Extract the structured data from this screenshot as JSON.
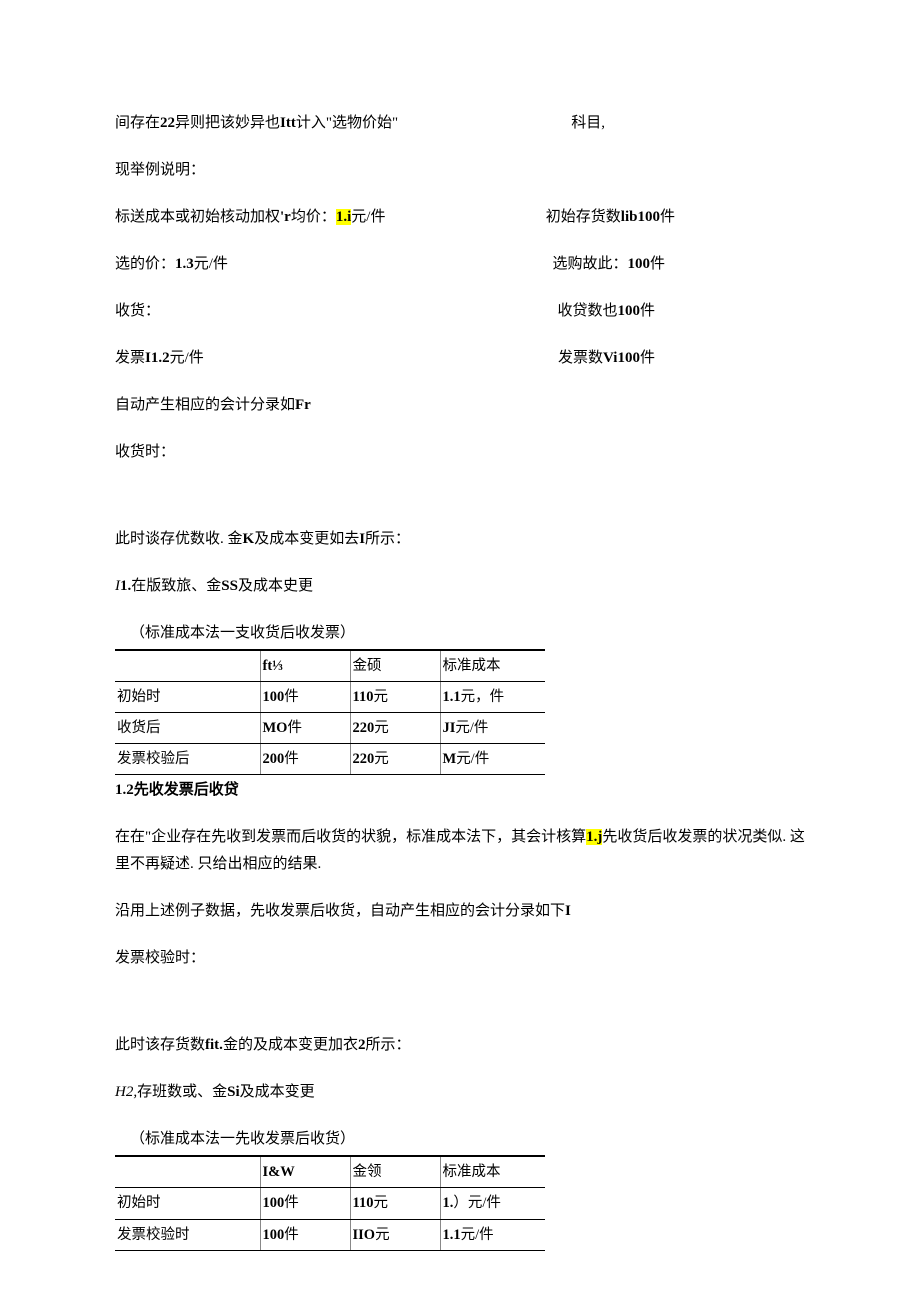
{
  "line1": {
    "left_a": "间存在",
    "left_b": "22",
    "left_c": "异则把该妙异也",
    "left_d": "Itt",
    "left_e": "计入\"选物价始\"",
    "right": "科目,"
  },
  "line2": "现举例说明：",
  "line3": {
    "left_a": "标送成本或初始核动加权",
    "left_b": "'r",
    "left_c": "均价：",
    "left_hl": "1.i",
    "left_d": "元/件",
    "right_a": "初始存货数",
    "right_b": "lib100",
    "right_c": "件"
  },
  "line4": {
    "left_a": "选的价：",
    "left_b": "1.3",
    "left_c": "元/件",
    "right_a": "选购故此：",
    "right_b": "100",
    "right_c": "件"
  },
  "line5": {
    "left": "收货：",
    "right_a": "收贷数也",
    "right_b": "100",
    "right_c": "件"
  },
  "line6": {
    "left_a": "发票",
    "left_b": "I1.2",
    "left_c": "元/件",
    "right_a": "发票数",
    "right_b": "Vi100",
    "right_c": "件"
  },
  "line7_a": "自动产生相应的会计分录如",
  "line7_b": "Fr",
  "line8": "收货时：",
  "line9_a": "此时谈存优数收. 金",
  "line9_b": "K",
  "line9_c": "及成本变更如去",
  "line9_d": "I",
  "line9_e": "所示：",
  "line10_a": "I",
  "line10_b": "1.",
  "line10_c": "在版致旅、金",
  "line10_d": "SS",
  "line10_e": "及成本史更",
  "table1": {
    "caption": "（标准成本法一支收货后收发票）",
    "header": [
      "",
      "ft⅓",
      "金硕",
      "标准成本"
    ],
    "rows": [
      {
        "c0": "初始时",
        "c1a": "100",
        "c1b": "件",
        "c2a": "110",
        "c2b": "元",
        "c3a": "1.1",
        "c3b": "元，件"
      },
      {
        "c0": "收货后",
        "c1a": "MO",
        "c1b": "件",
        "c2a": "220",
        "c2b": "元",
        "c3a": "JI",
        "c3b": "元/件"
      },
      {
        "c0": "发票校验后",
        "c1a": "200",
        "c1b": "件",
        "c2a": "220",
        "c2b": "元",
        "c3a": "M",
        "c3b": "元/件"
      }
    ]
  },
  "line11_a": "1.2",
  "line11_b": "先收发票后收贷",
  "line12_a": "在在\"企业存在先收到发票而后收货的状貌，标准成本法下，其会计核算",
  "line12_hl": "1.j",
  "line12_b": "先收货后收发票的状况类似. 这里不再疑述. 只给出相应的结果.",
  "line13": "沿用上述例子数据，先收发票后收货，自动产生相应的会计分录如下",
  "line13_b": "I",
  "line14": "发票校验时：",
  "line15_a": "此时该存货数",
  "line15_b": "fit.",
  "line15_c": "金的及成本变更加衣",
  "line15_d": "2",
  "line15_e": "所示：",
  "line16_a": "H2,",
  "line16_b": "存班数或、金",
  "line16_c": "Si",
  "line16_d": "及成本变更",
  "table2": {
    "caption": "（标准成本法一先收发票后收货）",
    "header": [
      "",
      "I&W",
      "金领",
      "标准成本"
    ],
    "rows": [
      {
        "c0": "初始时",
        "c1a": "100",
        "c1b": "件",
        "c2a": "110",
        "c2b": "元",
        "c3a": "1.",
        "c3b": "）元/件"
      },
      {
        "c0": "发票校验时",
        "c1a": "100",
        "c1b": "件",
        "c2a": "IIO",
        "c2b": "元",
        "c3a": "1.1",
        "c3b": "元/件"
      }
    ]
  }
}
